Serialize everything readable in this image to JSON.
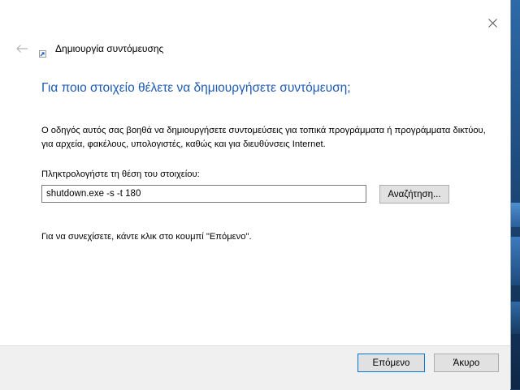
{
  "window": {
    "title": "Δημιουργία συντόμευσης"
  },
  "wizard": {
    "heading": "Για ποιο στοιχείο θέλετε να δημιουργήσετε συντόμευση;",
    "description": "Ο οδηγός αυτός σας βοηθά να δημιουργήσετε συντομεύσεις για τοπικά προγράμματα ή προγράμματα δικτύου, για αρχεία, φακέλους, υπολογιστές, καθώς και για διευθύνσεις Internet.",
    "location_label": "Πληκτρολογήστε τη θέση του στοιχείου:",
    "location_value": "shutdown.exe -s -t 180",
    "browse_label": "Αναζήτηση...",
    "hint": "Για να συνεχίσετε, κάντε κλικ στο κουμπί \"Επόμενο\"."
  },
  "footer": {
    "next_label": "Επόμενο",
    "cancel_label": "Άκυρο"
  },
  "icons": {
    "close": "close-icon",
    "back": "back-arrow-icon",
    "app": "shortcut-icon"
  },
  "colors": {
    "heading": "#1e5ab4",
    "default_button_border": "#0078d7"
  }
}
